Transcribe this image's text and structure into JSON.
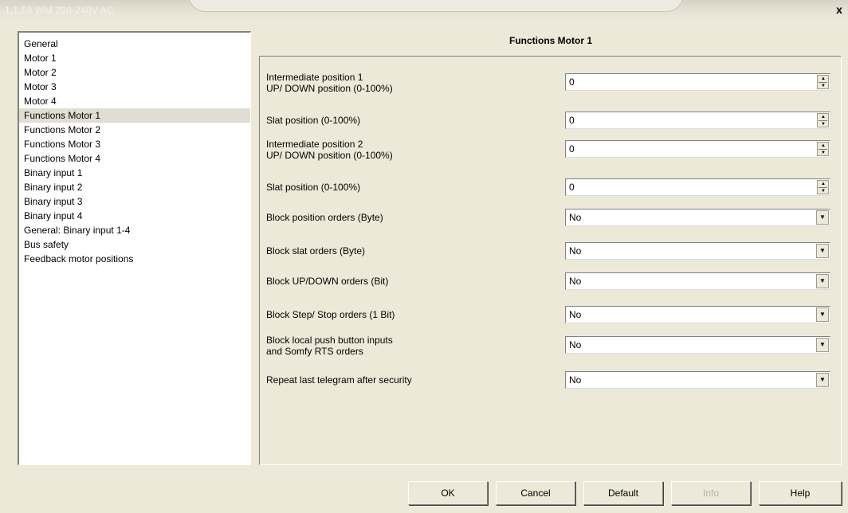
{
  "window": {
    "title": "1.1.58 WM 220-240V AC",
    "close_label": "x"
  },
  "tree": {
    "selected_index": 5,
    "items": [
      "General",
      "Motor 1",
      "Motor 2",
      "Motor 3",
      "Motor 4",
      "Functions Motor 1",
      "Functions Motor 2",
      "Functions Motor 3",
      "Functions Motor 4",
      "Binary input 1",
      "Binary input 2",
      "Binary input 3",
      "Binary input 4",
      "General: Binary input 1-4",
      "Bus safety",
      "Feedback motor positions"
    ]
  },
  "panel": {
    "header": "Functions Motor 1",
    "params": [
      {
        "label1": "Intermediate position 1",
        "label2": "UP/ DOWN position (0-100%)",
        "value": "0",
        "kind": "spin"
      },
      {
        "label1": "Slat position (0-100%)",
        "label2": "",
        "value": "0",
        "kind": "spin"
      },
      {
        "label1": "Intermediate position 2",
        "label2": "UP/ DOWN position (0-100%)",
        "value": "0",
        "kind": "spin"
      },
      {
        "label1": "Slat position (0-100%)",
        "label2": "",
        "value": "0",
        "kind": "spin"
      },
      {
        "label1": "Block position orders (Byte)",
        "label2": "",
        "value": "No",
        "kind": "select"
      },
      {
        "label1": "Block slat orders (Byte)",
        "label2": "",
        "value": "No",
        "kind": "select"
      },
      {
        "label1": "Block UP/DOWN orders (Bit)",
        "label2": "",
        "value": "No",
        "kind": "select"
      },
      {
        "label1": "Block Step/ Stop orders (1 Bit)",
        "label2": "",
        "value": "No",
        "kind": "select"
      },
      {
        "label1": "Block local push button inputs",
        "label2": "and Somfy RTS orders",
        "value": "No",
        "kind": "select"
      },
      {
        "label1": "Repeat last telegram after security",
        "label2": "",
        "value": "No",
        "kind": "select"
      }
    ]
  },
  "buttons": {
    "ok": "OK",
    "cancel": "Cancel",
    "default": "Default",
    "info": "Info",
    "help": "Help"
  },
  "icons": {
    "spin_up": "spin-up-icon",
    "spin_down": "spin-down-icon",
    "dropdown": "chevron-down-icon"
  }
}
